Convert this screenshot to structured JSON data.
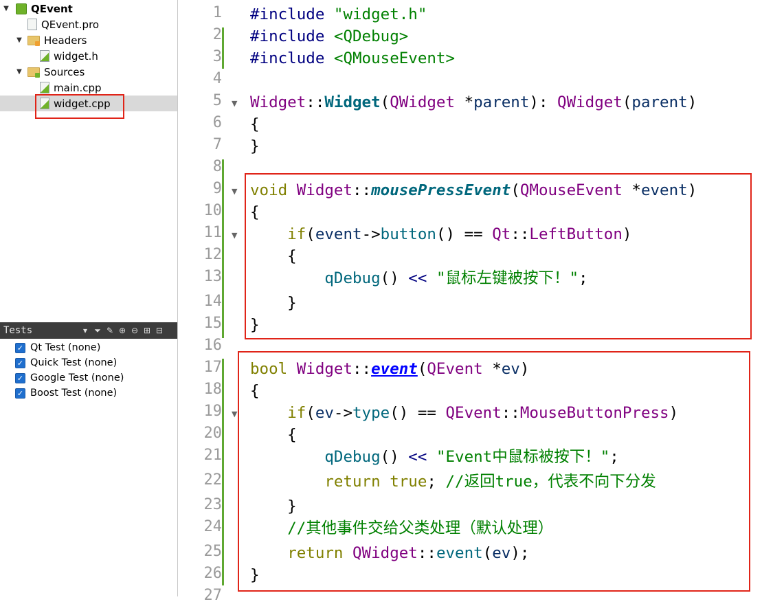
{
  "project_tree": {
    "project": "QEvent",
    "pro_file": "QEvent.pro",
    "headers_folder": "Headers",
    "header_file": "widget.h",
    "sources_folder": "Sources",
    "source_files": [
      "main.cpp",
      "widget.cpp"
    ],
    "selected_file": "widget.cpp"
  },
  "tests_panel": {
    "title": "Tests",
    "items": [
      "Qt Test (none)",
      "Quick Test (none)",
      "Google Test (none)",
      "Boost Test (none)"
    ]
  },
  "editor": {
    "line_numbers": [
      "1",
      "2",
      "3",
      "4",
      "5",
      "6",
      "7",
      "8",
      "9",
      "10",
      "11",
      "12",
      "13",
      "14",
      "15",
      "16",
      "17",
      "18",
      "19",
      "20",
      "21",
      "22",
      "23",
      "24",
      "25",
      "26",
      "27"
    ],
    "lines": [
      "#include \"widget.h\"",
      "#include <QDebug>",
      "#include <QMouseEvent>",
      "",
      "Widget::Widget(QWidget *parent): QWidget(parent)",
      "{",
      "}",
      "",
      "void Widget::mousePressEvent(QMouseEvent *event)",
      "{",
      "    if(event->button() == Qt::LeftButton)",
      "    {",
      "        qDebug() << \"鼠标左键被按下！\";",
      "    }",
      "}",
      "",
      "bool Widget::event(QEvent *ev)",
      "{",
      "    if(ev->type() == QEvent::MouseButtonPress)",
      "    {",
      "        qDebug() << \"Event中鼠标被按下！\";",
      "        return true; //返回true，代表不向下分发",
      "    }",
      "    //其他事件交给父类处理（默认处理）",
      "    return QWidget::event(ev);",
      "}"
    ]
  },
  "colors": {
    "highlight_box": "#e02418",
    "change_bar": "#5fa832",
    "tests_bar_bg": "#3c3c3c",
    "selection_bg": "#d9d9d9"
  }
}
